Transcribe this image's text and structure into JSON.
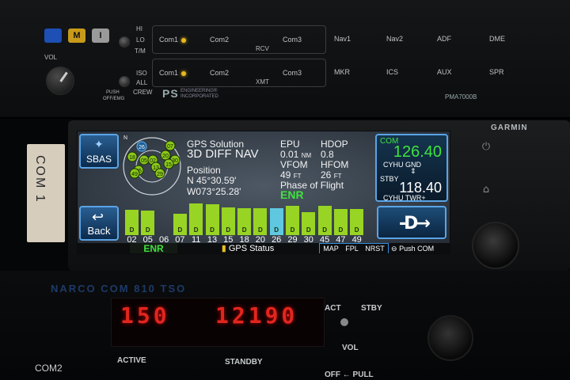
{
  "audio_panel": {
    "btn_b": "",
    "btn_m": "M",
    "btn_i": "I",
    "mode_hi": "HI",
    "mode_lo": "LO",
    "mode_tm": "T/M",
    "iso": "ISO",
    "all": "ALL",
    "crew": "CREW",
    "vol": "VOL",
    "push_label": "PUSH",
    "push_label2": "OFF/EMG",
    "rcv_label": "RCV",
    "xmt_label": "XMT",
    "rcv_row": [
      "Com1",
      "Com2",
      "Com3"
    ],
    "xmt_row": [
      "Com1",
      "Com2",
      "Com3"
    ],
    "nav_top": [
      "Nav1",
      "Nav2",
      "ADF",
      "DME"
    ],
    "nav_bot": [
      "MKR",
      "ICS",
      "AUX",
      "SPR"
    ],
    "brand": "PS",
    "brand_sub1": "ENGINEERING®",
    "brand_sub2": "INCORPORATED",
    "model": "PMA7000B"
  },
  "gtn": {
    "brand": "GARMIN",
    "sbas_label": "SBAS",
    "back_label": "Back",
    "compass_n": "N",
    "sky_sats": [
      "26",
      "07",
      "18",
      "20",
      "30",
      "05",
      "02",
      "15",
      "13",
      "45",
      "49",
      "29"
    ],
    "solution_label": "GPS Solution",
    "solution_value": "3D DIFF NAV",
    "position_label": "Position",
    "lat": "N 45°30.59'",
    "lon": "W073°25.28'",
    "epu_label": "EPU",
    "epu_value": "0.01",
    "epu_unit": "NM",
    "hdop_label": "HDOP",
    "hdop_value": "0.8",
    "vfom_label": "VFOM",
    "vfom_value": "49",
    "vfom_unit": "FT",
    "hfom_label": "HFOM",
    "hfom_value": "26",
    "hfom_unit": "FT",
    "phase_label": "Phase of Flight",
    "phase_value": "ENR",
    "signal_bars": [
      {
        "prn": "02",
        "level": 0.72,
        "type": "gps",
        "flag": "D"
      },
      {
        "prn": "05",
        "level": 0.7,
        "type": "gps",
        "flag": "D"
      },
      {
        "prn": "06",
        "level": 0.0,
        "type": "gps",
        "flag": ""
      },
      {
        "prn": "07",
        "level": 0.62,
        "type": "gps",
        "flag": "D"
      },
      {
        "prn": "11",
        "level": 0.9,
        "type": "gps",
        "flag": "D"
      },
      {
        "prn": "13",
        "level": 0.88,
        "type": "gps",
        "flag": "D"
      },
      {
        "prn": "15",
        "level": 0.8,
        "type": "gps",
        "flag": "D"
      },
      {
        "prn": "18",
        "level": 0.78,
        "type": "gps",
        "flag": "D"
      },
      {
        "prn": "20",
        "level": 0.77,
        "type": "gps",
        "flag": "D"
      },
      {
        "prn": "26",
        "level": 0.78,
        "type": "sbas",
        "flag": "D"
      },
      {
        "prn": "29",
        "level": 0.85,
        "type": "gps",
        "flag": "D"
      },
      {
        "prn": "30",
        "level": 0.65,
        "type": "gps",
        "flag": "D"
      },
      {
        "prn": "45",
        "level": 0.83,
        "type": "gps",
        "flag": "D"
      },
      {
        "prn": "47",
        "level": 0.76,
        "type": "gps",
        "flag": "D"
      },
      {
        "prn": "49",
        "level": 0.74,
        "type": "gps",
        "flag": "D"
      }
    ],
    "tab_enr": "ENR",
    "tab_gps_status": "GPS Status",
    "ctx_items": [
      "MAP",
      "FPL",
      "NRST"
    ],
    "push_com": "Push COM",
    "com_label": "COM",
    "com_active": "126.40",
    "com_active_id": "CYHU GND",
    "stby_label": "STBY",
    "com_stby": "118.40",
    "com_stby_id": "CYHU TWR+"
  },
  "placard": {
    "text": "COM 1"
  },
  "lower_radio": {
    "brand": "NARCO COM 810 TSO",
    "active_freq": "150",
    "standby_freq": "12190",
    "act": "ACT",
    "stby": "STBY",
    "vol": "VOL",
    "off_pull": "OFF ← PULL",
    "com2": "COM2",
    "active": "ACTIVE",
    "standby": "STANDBY"
  }
}
